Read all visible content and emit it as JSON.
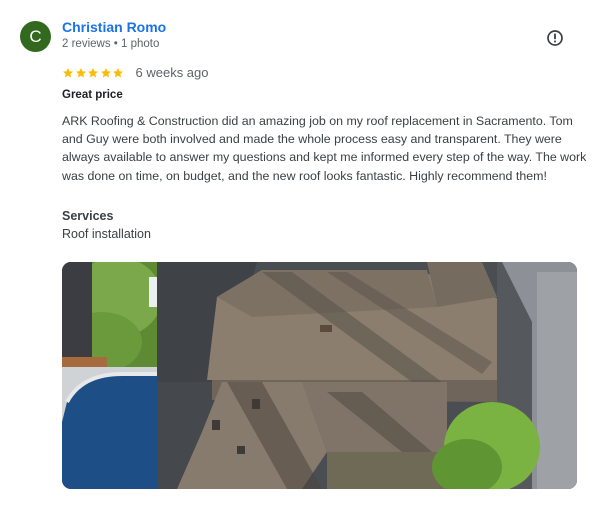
{
  "reviewer": {
    "initial": "C",
    "name": "Christian Romo",
    "meta": "2 reviews • 1 photo",
    "avatar_color": "#33691e"
  },
  "rating": {
    "stars": 5,
    "time_ago": "6 weeks ago",
    "star_color": "#fbbc04"
  },
  "review": {
    "headline": "Great price",
    "body": "ARK Roofing & Construction did an amazing job on my roof replacement in Sacramento. Tom and Guy were both involved and made the whole process easy and transparent. They were always available to answer my questions and kept me informed every step of the way. The work was done on time, on budget, and the new roof looks fantastic. Highly recommend them!"
  },
  "services": {
    "label": "Services",
    "value": "Roof installation"
  },
  "icons": {
    "more": "report-flag-icon",
    "star": "star-icon"
  },
  "colors": {
    "name_link": "#1a73e8",
    "muted_text": "#5f6368"
  }
}
